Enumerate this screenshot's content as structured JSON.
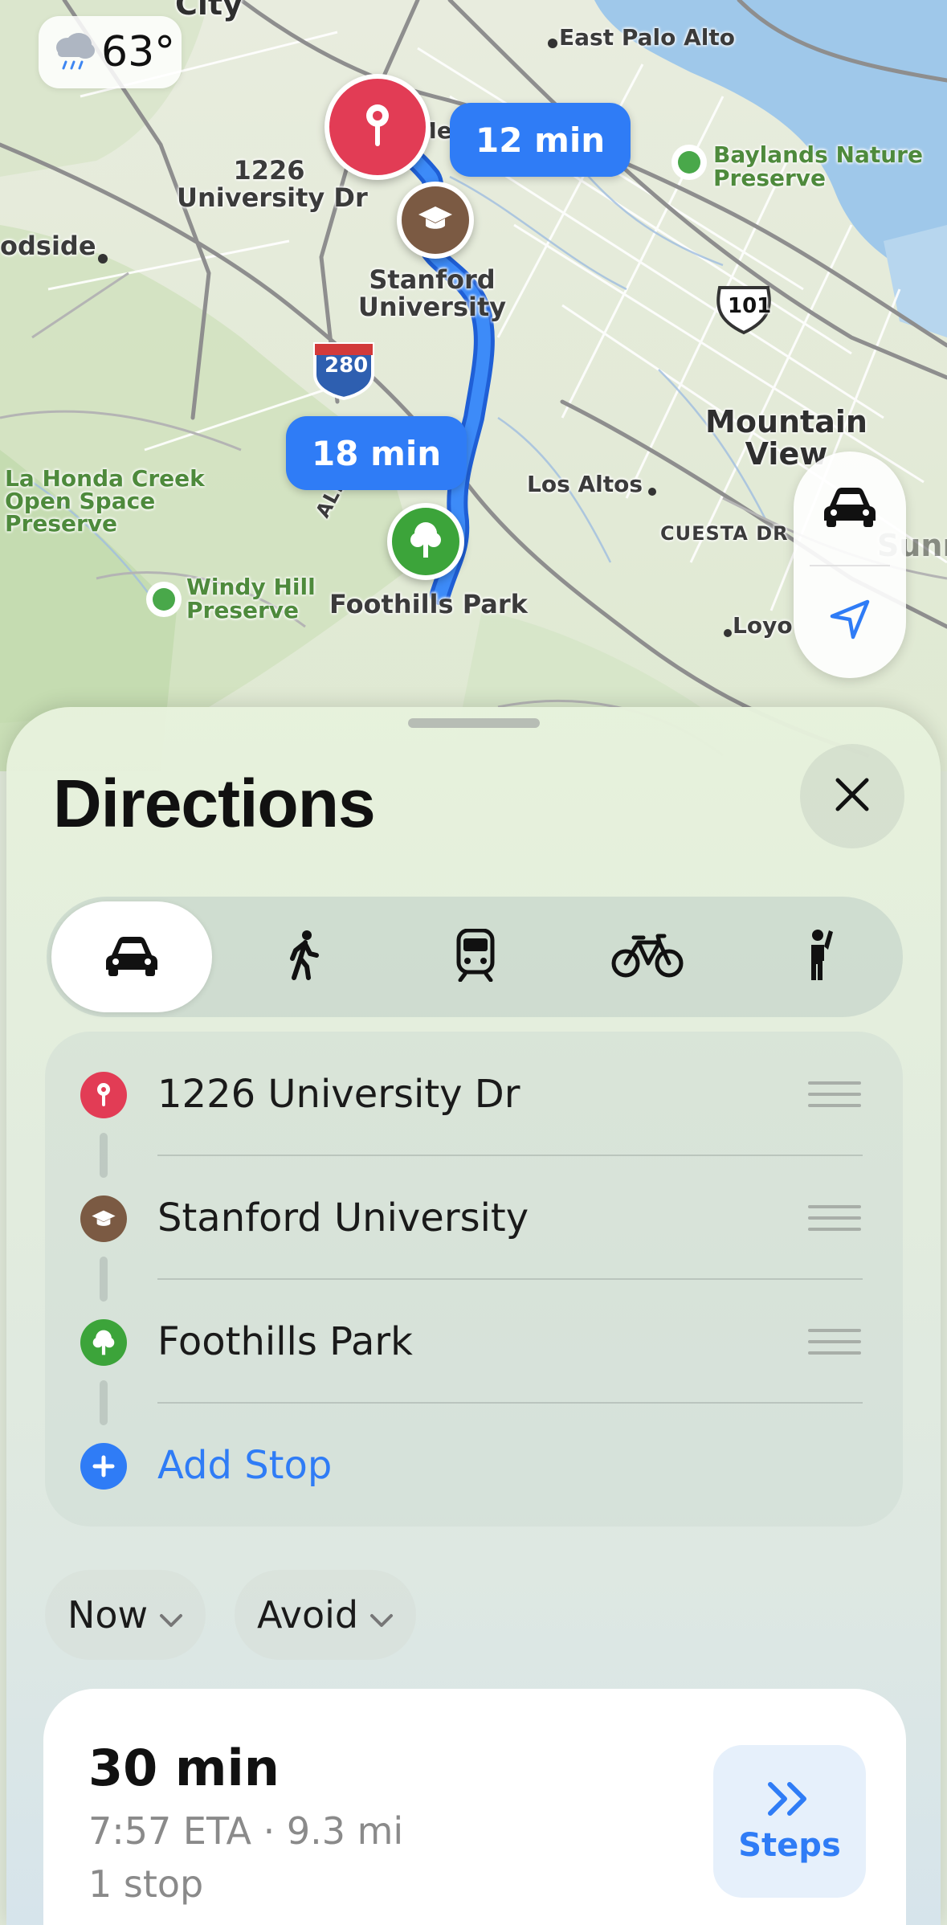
{
  "map": {
    "weather": {
      "icon": "cloud-rain-icon",
      "temperature": "63°"
    },
    "labels": {
      "city": "City",
      "east_palo_alto": "East Palo Alto",
      "menlo": "Me",
      "baylands": "Baylands Nature\nPreserve",
      "woodside": "odside",
      "start_pin": "1226\nUniversity Dr",
      "stanford": "Stanford\nUniversity",
      "hwy101": "101",
      "i280": "280",
      "mountain_view": "Mountain\nView",
      "la_honda": "La Honda Creek\nOpen Space\nPreserve",
      "los_altos": "Los Altos",
      "cuesta": "CUESTA DR",
      "alpine": "ALP",
      "windy_hill": "Windy Hill\nPreserve",
      "foothills": "Foothills Park",
      "loyola": "Loyo",
      "sunnyvale": "Sunny"
    },
    "route_bubbles": [
      "12 min",
      "18 min"
    ],
    "colors": {
      "route": "#2f7cf6",
      "start_pin": "#e23c55",
      "stanford_pin": "#7b5a43",
      "park_pin": "#3ca43a"
    }
  },
  "sheet": {
    "title": "Directions",
    "close_icon": "close-icon",
    "modes": [
      {
        "name": "drive",
        "icon": "car-icon",
        "active": true
      },
      {
        "name": "walk",
        "icon": "walk-icon",
        "active": false
      },
      {
        "name": "transit",
        "icon": "train-icon",
        "active": false
      },
      {
        "name": "cycle",
        "icon": "bicycle-icon",
        "active": false
      },
      {
        "name": "rideshare",
        "icon": "hail-icon",
        "active": false
      }
    ],
    "stops": [
      {
        "label": "1226 University Dr",
        "icon": "pin-icon"
      },
      {
        "label": "Stanford University",
        "icon": "graduation-cap-icon"
      },
      {
        "label": "Foothills Park",
        "icon": "tree-icon"
      }
    ],
    "add_stop": "Add Stop",
    "options": {
      "time": "Now",
      "avoid": "Avoid"
    },
    "route": {
      "duration": "30 min",
      "details": "7:57 ETA · 9.3 mi",
      "stops": "1 stop",
      "steps_label": "Steps"
    }
  }
}
